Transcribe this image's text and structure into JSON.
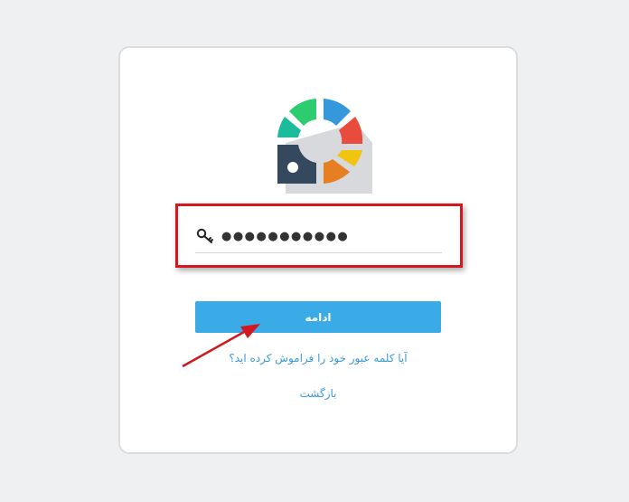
{
  "password": {
    "masked_value": "●●●●●●●●●●●",
    "icon": "key-icon"
  },
  "buttons": {
    "submit_label": "ادامه"
  },
  "links": {
    "forgot_password": "آیا کلمه عبور خود را فراموش کرده اید؟",
    "back": "بازگشت"
  },
  "colors": {
    "button_bg": "#3aabe7",
    "link": "#3a9ad9",
    "highlight": "#d2171e",
    "logo_segments": [
      "#2ecc71",
      "#3498db",
      "#e74c3c",
      "#f1c40f",
      "#e67e22",
      "#34495e",
      "#1abc9c"
    ]
  }
}
